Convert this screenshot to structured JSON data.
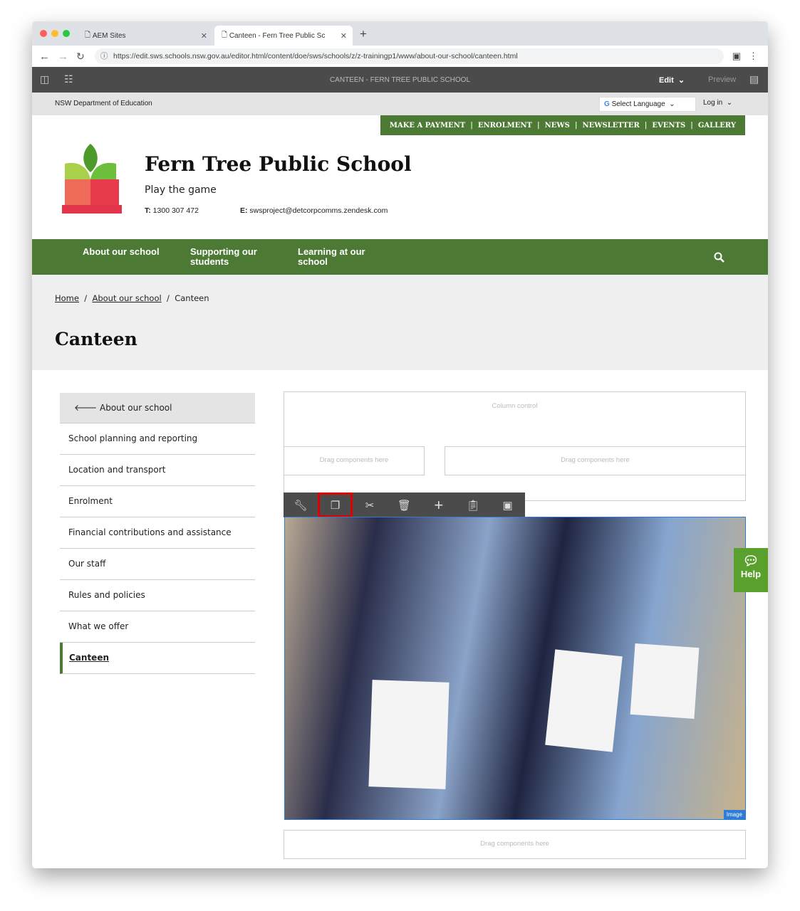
{
  "browser": {
    "tabs": [
      {
        "title": "AEM Sites"
      },
      {
        "title": "Canteen - Fern Tree Public Sc"
      }
    ],
    "url": "https://edit.sws.schools.nsw.gov.au/editor.html/content/doe/sws/schools/z/z-trainingp1/www/about-our-school/canteen.html"
  },
  "aem": {
    "page_title": "CANTEEN - FERN TREE PUBLIC SCHOOL",
    "edit": "Edit",
    "preview": "Preview"
  },
  "topbar": {
    "org": "NSW Department of Education",
    "language": "Select Language",
    "login": "Log in"
  },
  "quick_links": [
    "MAKE A PAYMENT",
    "ENROLMENT",
    "NEWS",
    "NEWSLETTER",
    "EVENTS",
    "GALLERY"
  ],
  "school": {
    "name": "Fern Tree Public School",
    "tagline": "Play the game",
    "phone_label": "T:",
    "phone": "1300 307 472",
    "email_label": "E:",
    "email": "swsproject@detcorpcomms.zendesk.com"
  },
  "nav": [
    "About our school",
    "Supporting our students",
    "Learning at our school"
  ],
  "breadcrumb": [
    "Home",
    "About our school",
    "Canteen"
  ],
  "page_title": "Canteen",
  "sidebar": {
    "back": "About our school",
    "items": [
      "School planning and reporting",
      "Location and transport",
      "Enrolment",
      "Financial contributions and assistance",
      "Our staff",
      "Rules and policies",
      "What we offer",
      "Canteen"
    ]
  },
  "editor": {
    "column_control": "Column control",
    "drag": "Drag components here",
    "image_label": "Image",
    "toolbar": [
      "wrench-icon",
      "copy-icon",
      "cut-icon",
      "delete-icon",
      "insert-icon",
      "paste-icon",
      "group-icon"
    ]
  },
  "help": "Help",
  "colors": {
    "brand_green": "#4c7a34",
    "selection_blue": "#2d7cd6",
    "highlight_red": "#e00000"
  }
}
